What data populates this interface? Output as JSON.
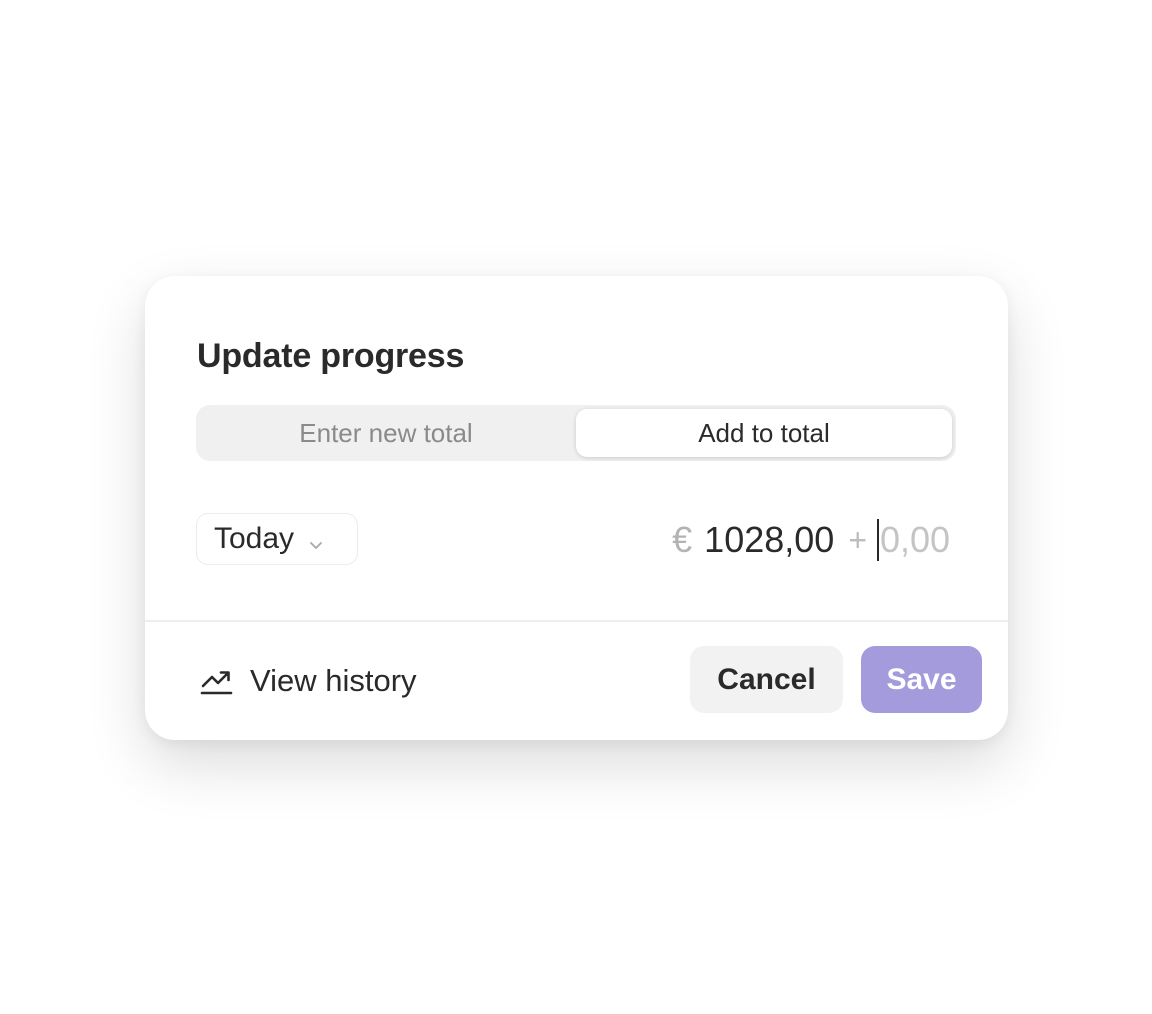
{
  "dialog": {
    "title": "Update progress",
    "mode_tabs": [
      {
        "label": "Enter new total",
        "selected": false
      },
      {
        "label": "Add to total",
        "selected": true
      }
    ],
    "date_select": {
      "value": "Today",
      "icon": "chevron-down-icon"
    },
    "amount": {
      "currency_symbol": "€",
      "current_total": "1028,00",
      "operator": "+",
      "add_value": "",
      "add_placeholder": "0,00"
    },
    "footer": {
      "history_label": "View history",
      "history_icon": "trending-up-icon",
      "cancel_label": "Cancel",
      "save_label": "Save"
    }
  },
  "colors": {
    "accent": "#a49bdc",
    "text": "#2a2a2a",
    "muted": "#b3b3b3",
    "segment_bg": "#f0f0f0",
    "cancel_bg": "#f2f2f2"
  }
}
